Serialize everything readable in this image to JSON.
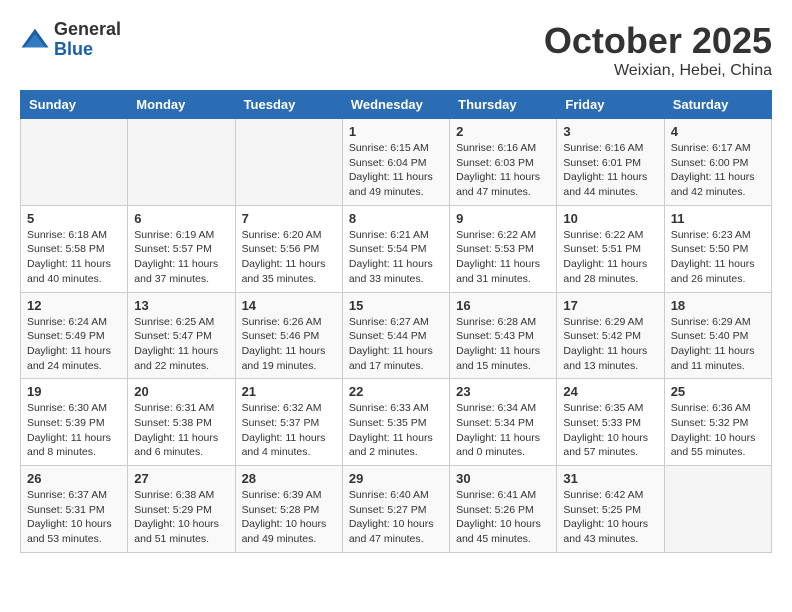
{
  "header": {
    "logo_line1": "General",
    "logo_line2": "Blue",
    "month": "October 2025",
    "location": "Weixian, Hebei, China"
  },
  "weekdays": [
    "Sunday",
    "Monday",
    "Tuesday",
    "Wednesday",
    "Thursday",
    "Friday",
    "Saturday"
  ],
  "weeks": [
    [
      {
        "day": "",
        "info": ""
      },
      {
        "day": "",
        "info": ""
      },
      {
        "day": "",
        "info": ""
      },
      {
        "day": "1",
        "info": "Sunrise: 6:15 AM\nSunset: 6:04 PM\nDaylight: 11 hours\nand 49 minutes."
      },
      {
        "day": "2",
        "info": "Sunrise: 6:16 AM\nSunset: 6:03 PM\nDaylight: 11 hours\nand 47 minutes."
      },
      {
        "day": "3",
        "info": "Sunrise: 6:16 AM\nSunset: 6:01 PM\nDaylight: 11 hours\nand 44 minutes."
      },
      {
        "day": "4",
        "info": "Sunrise: 6:17 AM\nSunset: 6:00 PM\nDaylight: 11 hours\nand 42 minutes."
      }
    ],
    [
      {
        "day": "5",
        "info": "Sunrise: 6:18 AM\nSunset: 5:58 PM\nDaylight: 11 hours\nand 40 minutes."
      },
      {
        "day": "6",
        "info": "Sunrise: 6:19 AM\nSunset: 5:57 PM\nDaylight: 11 hours\nand 37 minutes."
      },
      {
        "day": "7",
        "info": "Sunrise: 6:20 AM\nSunset: 5:56 PM\nDaylight: 11 hours\nand 35 minutes."
      },
      {
        "day": "8",
        "info": "Sunrise: 6:21 AM\nSunset: 5:54 PM\nDaylight: 11 hours\nand 33 minutes."
      },
      {
        "day": "9",
        "info": "Sunrise: 6:22 AM\nSunset: 5:53 PM\nDaylight: 11 hours\nand 31 minutes."
      },
      {
        "day": "10",
        "info": "Sunrise: 6:22 AM\nSunset: 5:51 PM\nDaylight: 11 hours\nand 28 minutes."
      },
      {
        "day": "11",
        "info": "Sunrise: 6:23 AM\nSunset: 5:50 PM\nDaylight: 11 hours\nand 26 minutes."
      }
    ],
    [
      {
        "day": "12",
        "info": "Sunrise: 6:24 AM\nSunset: 5:49 PM\nDaylight: 11 hours\nand 24 minutes."
      },
      {
        "day": "13",
        "info": "Sunrise: 6:25 AM\nSunset: 5:47 PM\nDaylight: 11 hours\nand 22 minutes."
      },
      {
        "day": "14",
        "info": "Sunrise: 6:26 AM\nSunset: 5:46 PM\nDaylight: 11 hours\nand 19 minutes."
      },
      {
        "day": "15",
        "info": "Sunrise: 6:27 AM\nSunset: 5:44 PM\nDaylight: 11 hours\nand 17 minutes."
      },
      {
        "day": "16",
        "info": "Sunrise: 6:28 AM\nSunset: 5:43 PM\nDaylight: 11 hours\nand 15 minutes."
      },
      {
        "day": "17",
        "info": "Sunrise: 6:29 AM\nSunset: 5:42 PM\nDaylight: 11 hours\nand 13 minutes."
      },
      {
        "day": "18",
        "info": "Sunrise: 6:29 AM\nSunset: 5:40 PM\nDaylight: 11 hours\nand 11 minutes."
      }
    ],
    [
      {
        "day": "19",
        "info": "Sunrise: 6:30 AM\nSunset: 5:39 PM\nDaylight: 11 hours\nand 8 minutes."
      },
      {
        "day": "20",
        "info": "Sunrise: 6:31 AM\nSunset: 5:38 PM\nDaylight: 11 hours\nand 6 minutes."
      },
      {
        "day": "21",
        "info": "Sunrise: 6:32 AM\nSunset: 5:37 PM\nDaylight: 11 hours\nand 4 minutes."
      },
      {
        "day": "22",
        "info": "Sunrise: 6:33 AM\nSunset: 5:35 PM\nDaylight: 11 hours\nand 2 minutes."
      },
      {
        "day": "23",
        "info": "Sunrise: 6:34 AM\nSunset: 5:34 PM\nDaylight: 11 hours\nand 0 minutes."
      },
      {
        "day": "24",
        "info": "Sunrise: 6:35 AM\nSunset: 5:33 PM\nDaylight: 10 hours\nand 57 minutes."
      },
      {
        "day": "25",
        "info": "Sunrise: 6:36 AM\nSunset: 5:32 PM\nDaylight: 10 hours\nand 55 minutes."
      }
    ],
    [
      {
        "day": "26",
        "info": "Sunrise: 6:37 AM\nSunset: 5:31 PM\nDaylight: 10 hours\nand 53 minutes."
      },
      {
        "day": "27",
        "info": "Sunrise: 6:38 AM\nSunset: 5:29 PM\nDaylight: 10 hours\nand 51 minutes."
      },
      {
        "day": "28",
        "info": "Sunrise: 6:39 AM\nSunset: 5:28 PM\nDaylight: 10 hours\nand 49 minutes."
      },
      {
        "day": "29",
        "info": "Sunrise: 6:40 AM\nSunset: 5:27 PM\nDaylight: 10 hours\nand 47 minutes."
      },
      {
        "day": "30",
        "info": "Sunrise: 6:41 AM\nSunset: 5:26 PM\nDaylight: 10 hours\nand 45 minutes."
      },
      {
        "day": "31",
        "info": "Sunrise: 6:42 AM\nSunset: 5:25 PM\nDaylight: 10 hours\nand 43 minutes."
      },
      {
        "day": "",
        "info": ""
      }
    ]
  ]
}
